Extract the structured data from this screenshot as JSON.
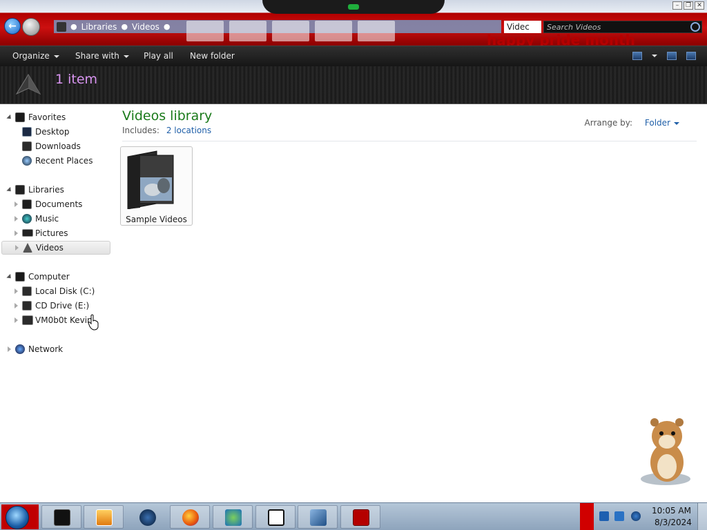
{
  "titlebar": {
    "window_controls": [
      "minimize",
      "restore",
      "close"
    ],
    "banner_text": "happy pride month"
  },
  "address": {
    "crumbs": [
      "Libraries",
      "Videos"
    ],
    "dropdown_text": "Videc"
  },
  "search": {
    "placeholder": "Search Videos"
  },
  "toolbar": {
    "organize": "Organize",
    "share_with": "Share with",
    "play_all": "Play all",
    "new_folder": "New folder"
  },
  "details": {
    "item_count": "1 item"
  },
  "nav": {
    "favorites": {
      "label": "Favorites",
      "items": [
        {
          "label": "Desktop",
          "icon": "desktop-icon"
        },
        {
          "label": "Downloads",
          "icon": "downloads-icon"
        },
        {
          "label": "Recent Places",
          "icon": "recent-places-icon"
        }
      ]
    },
    "libraries": {
      "label": "Libraries",
      "items": [
        {
          "label": "Documents",
          "icon": "documents-icon"
        },
        {
          "label": "Music",
          "icon": "music-icon"
        },
        {
          "label": "Pictures",
          "icon": "pictures-icon"
        },
        {
          "label": "Videos",
          "icon": "videos-icon",
          "selected": true
        }
      ]
    },
    "computer": {
      "label": "Computer",
      "items": [
        {
          "label": "Local Disk (C:)",
          "icon": "hard-drive-icon"
        },
        {
          "label": "CD Drive (E:)",
          "icon": "cd-drive-icon"
        },
        {
          "label": "VM0b0t Kevin",
          "icon": "network-drive-icon"
        }
      ]
    },
    "network": {
      "label": "Network"
    }
  },
  "content": {
    "title": "Videos library",
    "includes_label": "Includes:",
    "includes_link": "2 locations",
    "arrange_label": "Arrange by:",
    "arrange_value": "Folder",
    "items": [
      {
        "label": "Sample Videos",
        "icon": "video-folder-icon"
      }
    ]
  },
  "taskbar": {
    "pinned": [
      "explorer-icon",
      "media-player-icon",
      "globe-icon",
      "firefox-icon",
      "messenger-icon",
      "7zip-icon",
      "virtualbox-icon",
      "dos-icon"
    ],
    "clock_time": "10:05 AM",
    "clock_date": "8/3/2024"
  },
  "colors": {
    "accent_green": "#1a7a1a",
    "link_blue": "#1f5fa8",
    "item_count_pink": "#d894f0",
    "banner_red": "#cc1010"
  }
}
